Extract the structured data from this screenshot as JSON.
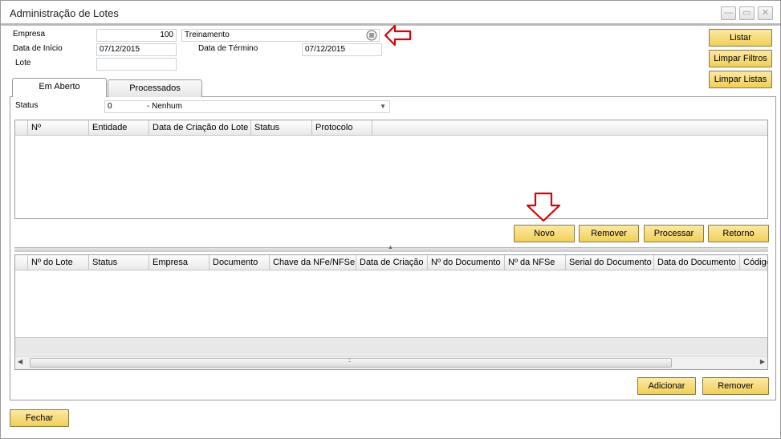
{
  "window": {
    "title": "Administração de Lotes",
    "controls": [
      "—",
      "▭",
      "✕"
    ]
  },
  "form": {
    "empresa_label": "Empresa",
    "empresa_value": "100",
    "empresa_name": "Treinamento",
    "data_inicio_label": "Data de Início",
    "data_inicio_value": "07/12/2015",
    "data_termino_label": "Data de Término",
    "data_termino_value": "07/12/2015",
    "lote_label": "Lote",
    "lote_value": ""
  },
  "side_buttons": {
    "listar": "Listar",
    "limpar_filtros": "Limpar Filtros",
    "limpar_listas": "Limpar Listas"
  },
  "tabs": {
    "open": "Em Aberto",
    "processed": "Processados"
  },
  "status": {
    "label": "Status",
    "code": "0",
    "text": "- Nenhum"
  },
  "grid1": {
    "columns": [
      "Nº",
      "Entidade",
      "Data de Criação do Lote",
      "Status",
      "Protocolo"
    ]
  },
  "grid1_buttons": {
    "novo": "Novo",
    "remover": "Remover",
    "processar": "Processar",
    "retorno": "Retorno"
  },
  "grid2": {
    "columns": [
      "Nº do Lote",
      "Status",
      "Empresa",
      "Documento",
      "Chave da NFe/NFSe",
      "Data de Criação",
      "Nº do Documento",
      "Nº da NFSe",
      "Serial do Documento",
      "Data do Documento",
      "Código"
    ]
  },
  "grid2_buttons": {
    "adicionar": "Adicionar",
    "remover": "Remover"
  },
  "footer": {
    "fechar": "Fechar"
  },
  "colors": {
    "button_gold_top": "#fbe9a4",
    "button_gold_bottom": "#f2cf5a",
    "arrow_red": "#e00000"
  }
}
